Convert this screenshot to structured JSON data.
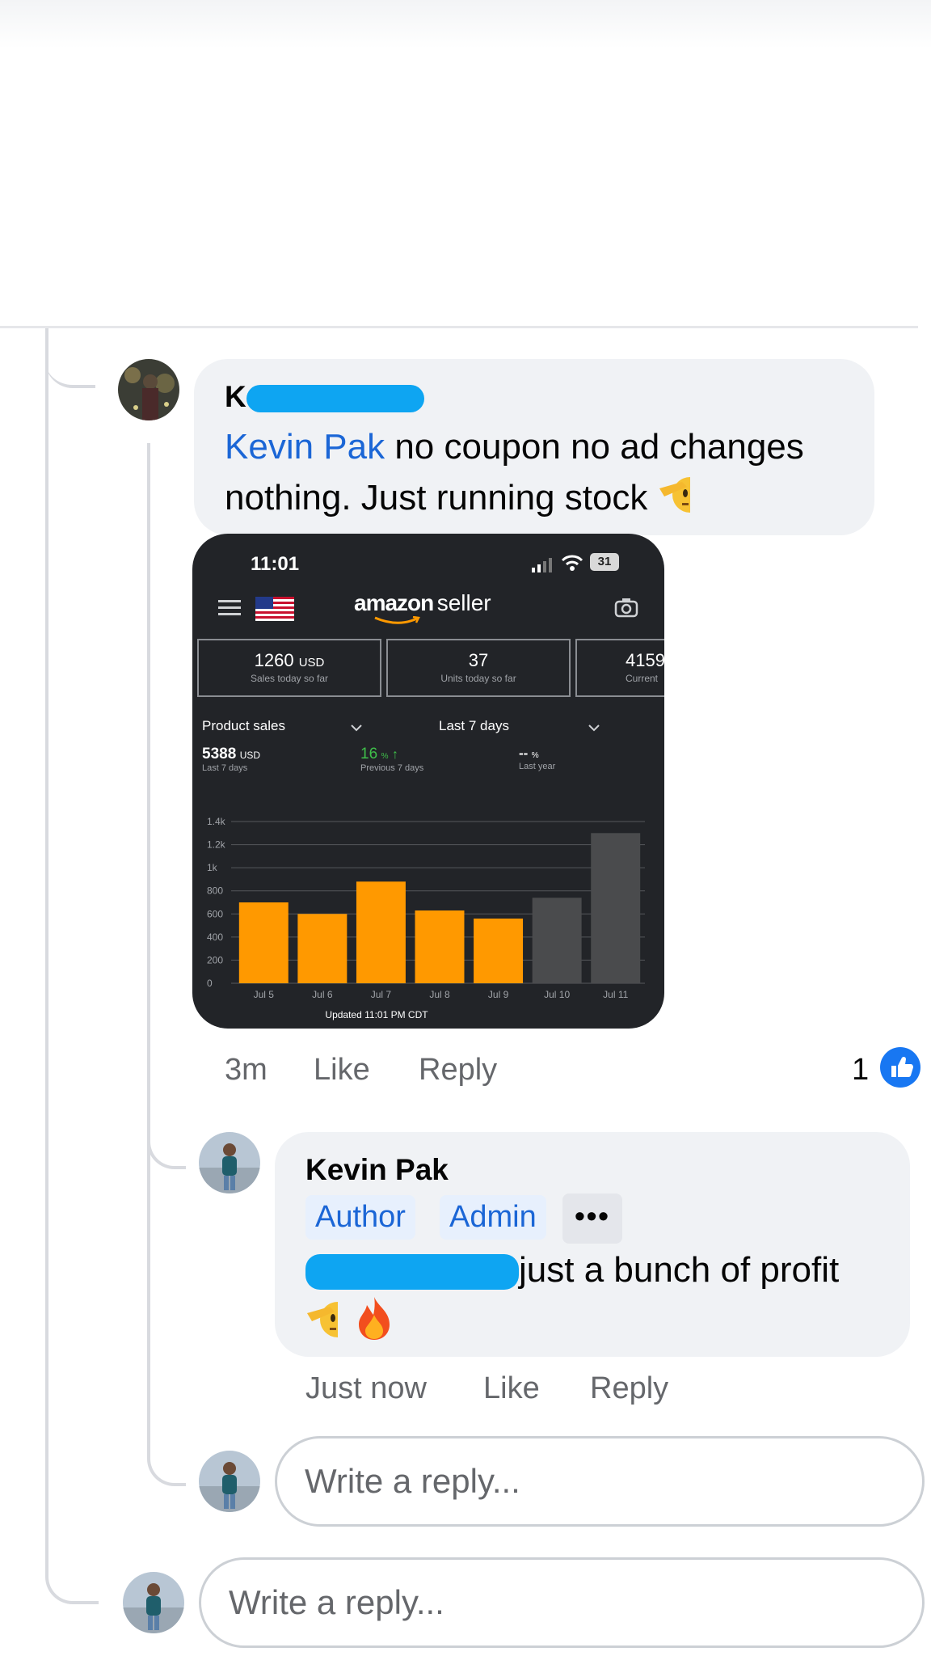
{
  "comment1": {
    "author_initial": "K",
    "mention": "Kevin Pak",
    "text_line1": " no coupon no ad changes",
    "text_line2": "nothing. Just running stock",
    "time": "3m",
    "like": "Like",
    "reply": "Reply",
    "reaction_count": "1"
  },
  "screenshot": {
    "status_time": "11:01",
    "battery": "31",
    "logo_word1": "amazon",
    "logo_word2": "seller",
    "stats": [
      {
        "value": "1260",
        "unit": "USD",
        "caption": "Sales today so far"
      },
      {
        "value": "37",
        "unit": "",
        "caption": "Units today so far"
      },
      {
        "value": "4159",
        "unit": "",
        "caption": "Current"
      }
    ],
    "metric_selector": "Product sales",
    "period_selector": "Last 7 days",
    "summary": [
      {
        "value": "5388",
        "unit": "USD",
        "caption": "Last 7 days"
      },
      {
        "value": "16",
        "unit": "%",
        "caption": "Previous 7 days"
      },
      {
        "value": "--",
        "unit": "%",
        "caption": "Last year"
      }
    ],
    "footer": "Updated 11:01 PM CDT"
  },
  "chart_data": {
    "type": "bar",
    "categories": [
      "Jul 5",
      "Jul 6",
      "Jul 7",
      "Jul 8",
      "Jul 9",
      "Jul 10",
      "Jul 11"
    ],
    "values": [
      700,
      600,
      880,
      630,
      560,
      740,
      1300
    ],
    "bar_colors": [
      "#ff9900",
      "#ff9900",
      "#ff9900",
      "#ff9900",
      "#ff9900",
      "#4a4b4d",
      "#4a4b4d"
    ],
    "yticks": [
      "0",
      "200",
      "400",
      "600",
      "800",
      "1k",
      "1.2k",
      "1.4k"
    ],
    "ylim": [
      0,
      1400
    ],
    "grid": true
  },
  "comment2": {
    "author": "Kevin Pak",
    "badge_author": "Author",
    "badge_admin": "Admin",
    "more": "•••",
    "text": "just a bunch of profit",
    "time": "Just now",
    "like": "Like",
    "reply": "Reply"
  },
  "reply_inner": {
    "placeholder": "Write a reply..."
  },
  "reply_outer": {
    "placeholder": "Write a reply..."
  },
  "colors": {
    "link_blue": "#1b66d6",
    "bubble_gray": "#f0f2f5",
    "redaction": "#0ea5f2",
    "bar_orange": "#ff9900"
  },
  "icons": [
    "saluting-face-emoji",
    "fire-emoji",
    "like-reaction-icon",
    "hamburger-menu-icon",
    "us-flag-icon",
    "camera-icon"
  ]
}
